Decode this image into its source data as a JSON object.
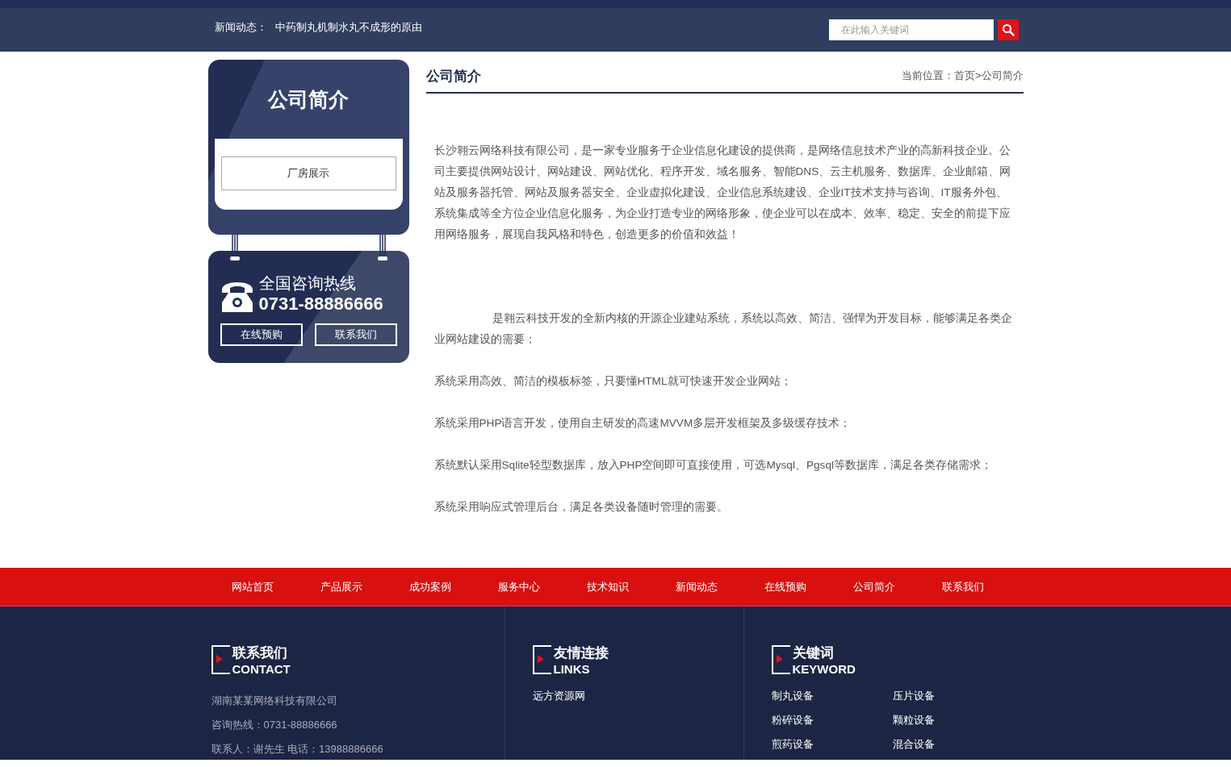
{
  "header": {
    "news_label": "新闻动态：",
    "news_title": "中药制丸机制水丸不成形的原由",
    "search": {
      "placeholder": "在此输入关键词"
    }
  },
  "sidebar": {
    "title": "公司简介",
    "items": [
      {
        "label": "厂房展示",
        "selected": false
      }
    ],
    "hotline": {
      "label": "全国咨询热线",
      "phone": "0731-88886666",
      "buttons": [
        "在线预购",
        "联系我们"
      ]
    }
  },
  "main": {
    "title": "公司简介",
    "breadcrumb_label": "当前位置：",
    "breadcrumb": [
      "首页",
      "公司简介"
    ],
    "breadcrumb_sep": ">",
    "paragraphs": [
      {
        "text": "长沙翱云网络科技有限公司，是一家专业服务于企业信息化建设的提供商，是网络信息技术产业的高新科技企业。公司主要提供网站设计、网站建设、网站优化、程序开发、域名服务、智能DNS、云主机服务、数据库、企业邮箱、网站及服务器托管、网站及服务器安全、企业虚拟化建设、企业信息系统建设、企业IT技术支持与咨询、IT服务外包、系统集成等全方位企业信息化服务，为企业打造专业的网络形象，使企业可以在成本、效率、稳定、安全的前提下应用网络服务，展现自我风格和特色，创造更多的价值和效益！",
        "indent": false
      },
      {
        "text": "是翱云科技开发的全新内核的开源企业建站系统，系统以高效、简洁、强悍为开发目标，能够满足各类企业网站建设的需要；",
        "indent": true
      },
      {
        "text": "系统采用高效、简洁的模板标签，只要懂HTML就可快速开发企业网站；",
        "indent": false
      },
      {
        "text": "系统采用PHP语言开发，使用自主研发的高速MVVM多层开发框架及多级缓存技术；",
        "indent": false
      },
      {
        "text": "系统默认采用Sqlite轻型数据库，放入PHP空间即可直接使用，可选Mysql、Pgsql等数据库，满足各类存储需求；",
        "indent": false
      },
      {
        "text": "系统采用响应式管理后台，满足各类设备随时管理的需要。",
        "indent": false
      }
    ]
  },
  "footer_nav": [
    "网站首页",
    "产品展示",
    "成功案例",
    "服务中心",
    "技术知识",
    "新闻动态",
    "在线预购",
    "公司简介",
    "联系我们"
  ],
  "footer": {
    "contact": {
      "title": "联系我们",
      "subtitle": "CONTACT",
      "lines": [
        "湖南某某网络科技有限公司",
        "咨询热线：0731-88886666",
        "联系人：谢先生 电话：13988886666"
      ]
    },
    "links": {
      "title": "友情连接",
      "subtitle": "LINKS",
      "items": [
        "远方资源网"
      ]
    },
    "keywords": {
      "title": "关键词",
      "subtitle": "KEYWORD",
      "items": [
        "制丸设备",
        "压片设备",
        "粉碎设备",
        "颗粒设备",
        "煎药设备",
        "混合设备"
      ]
    }
  }
}
